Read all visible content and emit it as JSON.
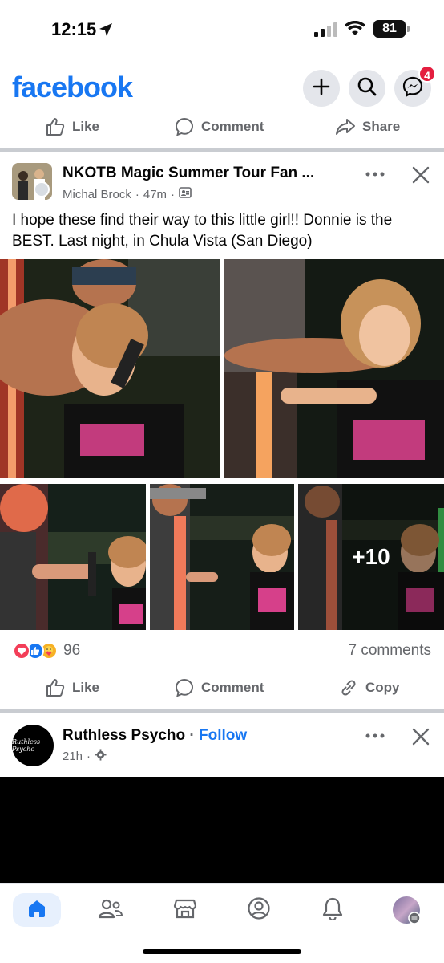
{
  "status_bar": {
    "time": "12:15",
    "battery": "81"
  },
  "header": {
    "logo": "facebook",
    "messenger_badge": "4"
  },
  "top_actions": {
    "like": "Like",
    "comment": "Comment",
    "share": "Share"
  },
  "post": {
    "group_name": "NKOTB Magic Summer Tour Fan ...",
    "author": "Michal Brock",
    "time": "47m",
    "separator": "·",
    "text": "I hope these find their way to this little girl!! Donnie is the BEST. Last night, in Chula Vista (San Diego)",
    "more_photos": "+10",
    "reaction_count": "96",
    "comments_count": "7 comments",
    "actions": {
      "like": "Like",
      "comment": "Comment",
      "copy": "Copy"
    }
  },
  "post2": {
    "page_name": "Ruthless Psycho",
    "dot": " · ",
    "follow": "Follow",
    "time": "21h",
    "separator": "·",
    "avatar_text": "Ruthless Psycho"
  },
  "colors": {
    "brand": "#1877f2",
    "secondary_text": "#65676b",
    "badge": "#e41e3f"
  },
  "icons": [
    "location-arrow-icon",
    "signal-icon",
    "wifi-icon",
    "plus-icon",
    "search-icon",
    "messenger-icon",
    "like-icon",
    "comment-icon",
    "share-icon",
    "copy-link-icon",
    "more-icon",
    "close-icon",
    "group-privacy-icon",
    "settings-icon",
    "home-icon",
    "friends-icon",
    "marketplace-icon",
    "profile-icon",
    "bell-icon"
  ]
}
